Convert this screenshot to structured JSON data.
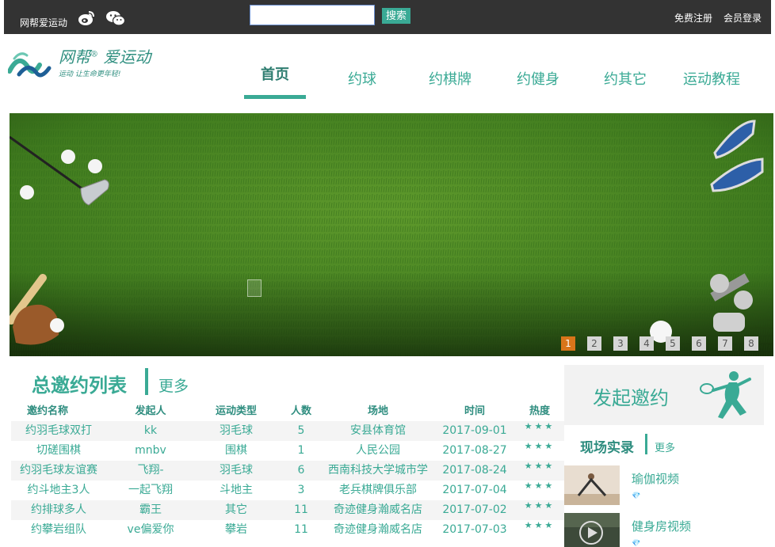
{
  "topbar": {
    "site_name": "网帮爱运动",
    "weibo_icon": "weibo-icon",
    "wechat_icon": "wechat-icon",
    "search_value": "",
    "search_button": "搜索",
    "register": "免费注册",
    "login": "会员登录"
  },
  "logo": {
    "title": "网帮",
    "registered": "®",
    "title2": "爱运动",
    "slogan": "运动 让生命更年轻!"
  },
  "nav": {
    "items": [
      "首页",
      "约球",
      "约棋牌",
      "约健身",
      "约其它",
      "运动教程"
    ],
    "active_index": 0
  },
  "banner": {
    "slides": [
      "1",
      "2",
      "3",
      "4",
      "5",
      "6",
      "7",
      "8"
    ],
    "active_slide": 1
  },
  "invite_list": {
    "title": "总邀约列表",
    "more": "更多",
    "columns": [
      "邀约名称",
      "发起人",
      "运动类型",
      "人数",
      "场地",
      "时间",
      "热度"
    ],
    "rows": [
      [
        "约羽毛球双打",
        "kk",
        "羽毛球",
        "5",
        "安县体育馆",
        "2017-09-01",
        "★★★"
      ],
      [
        "切磋围棋",
        "mnbv",
        "围棋",
        "1",
        "人民公园",
        "2017-08-27",
        "★★★"
      ],
      [
        "约羽毛球友谊赛",
        "飞翔-",
        "羽毛球",
        "6",
        "西南科技大学城市学",
        "2017-08-24",
        "★★★"
      ],
      [
        "约斗地主3人",
        "一起飞翔",
        "斗地主",
        "3",
        "老兵棋牌俱乐部",
        "2017-07-04",
        "★★★"
      ],
      [
        "约排球多人",
        "霸王",
        "其它",
        "11",
        "奇迹健身瀚威名店",
        "2017-07-02",
        "★★★"
      ],
      [
        "约攀岩组队",
        "ve偏爱你",
        "攀岩",
        "11",
        "奇迹健身瀚威名店",
        "2017-07-03",
        "★★★"
      ]
    ]
  },
  "sidebar": {
    "invite_button": "发起邀约",
    "live_title": "现场实录",
    "live_more": "更多",
    "videos": [
      {
        "title": "瑜伽视频",
        "gem": "💎"
      },
      {
        "title": "健身房视频",
        "gem": "💎"
      }
    ]
  },
  "colors": {
    "accent": "#3aaa95",
    "topbar": "#333333",
    "active_slide": "#d9751a"
  }
}
